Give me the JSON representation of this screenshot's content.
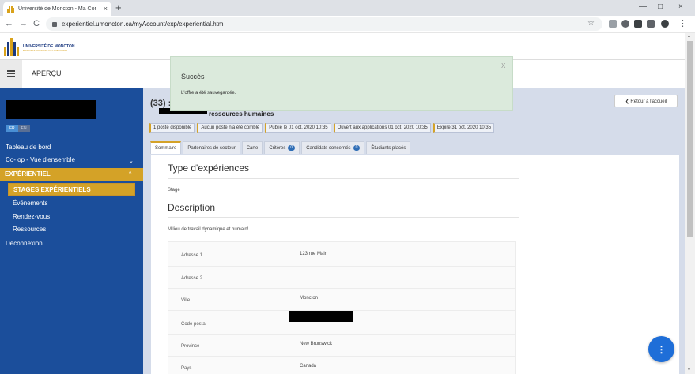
{
  "browser": {
    "tab_title": "Université de Moncton - Ma Cor",
    "tab_close": "×",
    "new_tab": "+",
    "url": "experientiel.umoncton.ca/myAccount/exp/experiential.htm",
    "minimize": "—",
    "maximize": "□",
    "close": "×",
    "back": "←",
    "forward": "→",
    "reload": "C",
    "star": "☆",
    "menu": "⋮"
  },
  "site": {
    "logo_line1": "UNIVERSITÉ DE MONCTON",
    "logo_line2": "EDMUNDSTON  MONCTON  SHIPPAGAN",
    "logo_colors": [
      "#d9a21b",
      "#1c3a80"
    ],
    "menu_label": "APERÇU"
  },
  "sidebar": {
    "lang_fr": "FR",
    "lang_en": "EN",
    "dashboard": "Tableau de bord",
    "coop": "Co- op - Vue d'ensemble",
    "experiential": "EXPÉRIENTIEL",
    "stages": "STAGES EXPÉRIENTIELS",
    "events": "Événements",
    "appointments": "Rendez-vous",
    "resources": "Ressources",
    "logout": "Déconnexion",
    "chevron_down": "⌄",
    "chevron_up": "^",
    "accent": "#d4a227",
    "background": "#1b4e9b"
  },
  "job": {
    "number": "(33) :",
    "title_rest": "ressources humaines",
    "back_button": "❮  Retour à l'accueil",
    "badges": [
      "1 poste disponible",
      "Aucun poste n'a été comblé",
      "Publié le 01 oct. 2020 10:35",
      "Ouvert aux applications 01 oct. 2020 10:35",
      "Expire 31 oct. 2020 10:35"
    ],
    "tabs": [
      {
        "label": "Sommaire"
      },
      {
        "label": "Partenaires de secteur"
      },
      {
        "label": "Carte"
      },
      {
        "label": "Critères",
        "count": "0"
      },
      {
        "label": "Candidats concernés",
        "count": "0"
      },
      {
        "label": "Étudiants placés"
      }
    ]
  },
  "content": {
    "section1_title": "Type d'expériences",
    "section1_value": "Stage",
    "section2_title": "Description",
    "section2_value": "Milieu de travail dynamique et humain!",
    "address": {
      "adresse1_label": "Adresse 1",
      "adresse1_value": "123 rue Main",
      "adresse2_label": "Adresse 2",
      "ville_label": "Ville",
      "ville_value": "Moncton",
      "postal_label": "Code postal",
      "province_label": "Province",
      "province_value": "New Brunswick",
      "pays_label": "Pays",
      "pays_value": "Canada"
    }
  },
  "toast": {
    "title": "Succès",
    "message": "L'offre a été sauvegardée.",
    "close": "X"
  },
  "fab": {
    "label": "⋮"
  }
}
